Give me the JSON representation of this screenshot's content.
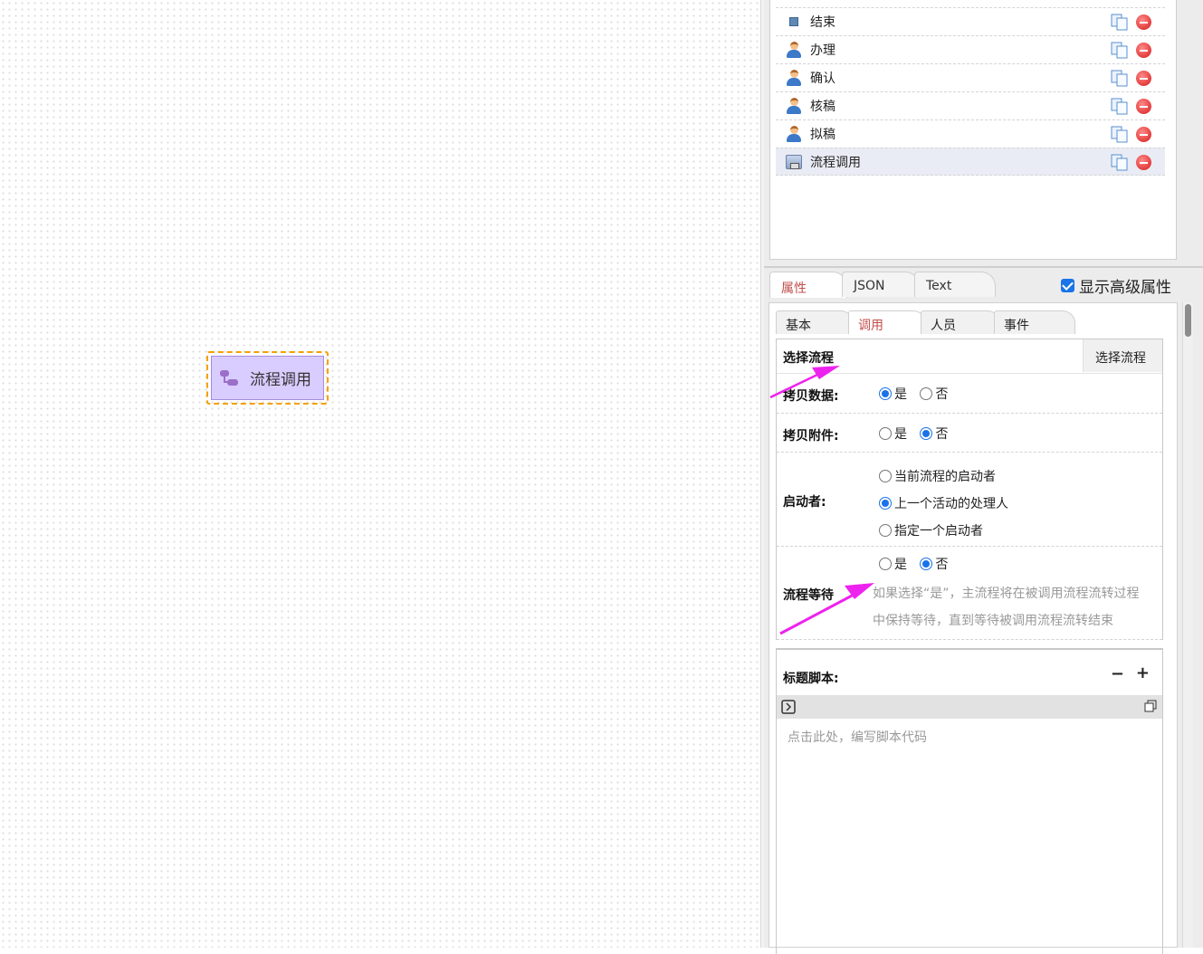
{
  "canvas": {
    "node_label": "流程调用"
  },
  "activities": [
    {
      "name": "结束",
      "icon": "end-square-icon"
    },
    {
      "name": "办理",
      "icon": "user-icon"
    },
    {
      "name": "确认",
      "icon": "user-icon"
    },
    {
      "name": "核稿",
      "icon": "user-icon"
    },
    {
      "name": "拟稿",
      "icon": "user-icon"
    },
    {
      "name": "流程调用",
      "icon": "subprocess-icon"
    }
  ],
  "property_tabs": [
    "属性",
    "JSON",
    "Text"
  ],
  "show_advanced": {
    "label": "显示高级属性",
    "checked": true
  },
  "sub_tabs": [
    "基本",
    "调用",
    "人员",
    "事件"
  ],
  "form": {
    "select_process": {
      "label": "选择流程",
      "button": "选择流程"
    },
    "copy_data": {
      "label": "拷贝数据:",
      "options": [
        "是",
        "否"
      ],
      "selected": "是"
    },
    "copy_attachment": {
      "label": "拷贝附件:",
      "options": [
        "是",
        "否"
      ],
      "selected": "否"
    },
    "starter": {
      "label": "启动者:",
      "options": [
        "当前流程的启动者",
        "上一个活动的处理人",
        "指定一个启动者"
      ],
      "selected": "上一个活动的处理人"
    },
    "wait": {
      "label": "流程等待",
      "options": [
        "是",
        "否"
      ],
      "selected": "否",
      "hint_line1": "如果选择“是”，主流程将在被调用流程流转过程",
      "hint_line2": "中保持等待，直到等待被调用流程流转结束"
    }
  },
  "script": {
    "label": "标题脚本:",
    "collapse": "−",
    "expand": "+",
    "placeholder": "点击此处，编写脚本代码"
  },
  "colors": {
    "accent": "#c0504d",
    "arrow": "#ee22ee",
    "selection_border": "#f5a000",
    "node_fill": "#d9ccff"
  }
}
